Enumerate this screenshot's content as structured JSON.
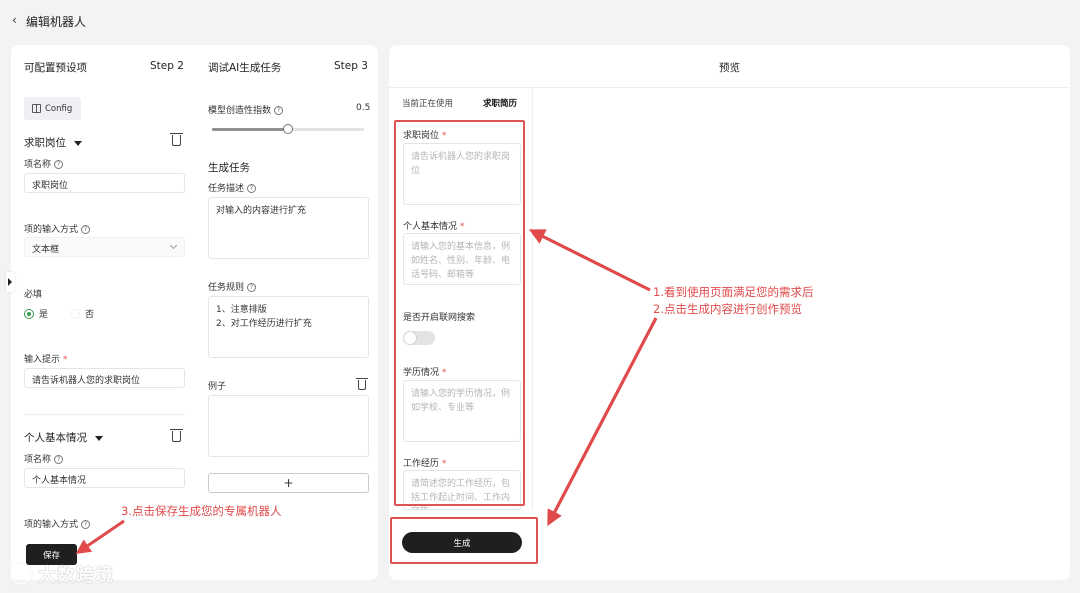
{
  "header": {
    "back_icon": "‹",
    "title": "编辑机器人"
  },
  "config_panel": {
    "title": "可配置预设项",
    "step": "Step 2",
    "config_button": "Config",
    "fields": [
      {
        "group_title": "求职岗位",
        "name_label": "项名称",
        "name_value": "求职岗位",
        "input_type_label": "项的输入方式",
        "input_type_value": "文本框",
        "required_label": "必填",
        "required_yes": "是",
        "required_no": "否",
        "hint_label": "输入提示",
        "hint_value": "请告诉机器人您的求职岗位"
      },
      {
        "group_title": "个人基本情况",
        "name_label": "项名称",
        "name_value": "个人基本情况",
        "input_type_label": "项的输入方式"
      }
    ],
    "save_button": "保存"
  },
  "ai_panel": {
    "title": "调试AI生成任务",
    "step": "Step 3",
    "creativity_label": "模型创造性指数",
    "creativity_value": "0.5",
    "creativity_fraction": 0.5,
    "section_title": "生成任务",
    "task_desc_label": "任务描述",
    "task_desc_value": "对输入的内容进行扩充",
    "task_rules_label": "任务规则",
    "task_rules_lines": [
      "1、注意排版",
      "2、对工作经历进行扩充"
    ],
    "example_label": "例子",
    "add_button": "+"
  },
  "preview_panel": {
    "title": "预览",
    "tab_current": "当前正在使用",
    "tab_active": "求职简历",
    "fields": [
      {
        "label": "求职岗位",
        "placeholder": "请告诉机器人您的求职岗位"
      },
      {
        "label": "个人基本情况",
        "placeholder": "请输入您的基本信息，例如姓名、性别、年龄、电话号码、邮箱等"
      },
      {
        "label": "是否开启联网搜索"
      },
      {
        "label": "学历情况",
        "placeholder": "请输入您的学历情况，例如学校、专业等"
      },
      {
        "label": "工作经历",
        "placeholder": "请简述您的工作经历，包括工作起止时间、工作内容等"
      }
    ],
    "generate_button": "生成"
  },
  "annotations": {
    "note1_line1": "1.看到使用页面满足您的需求后",
    "note1_line2": "2.点击生成内容进行创作预览",
    "note2": "3.点击保存生成您的专属机器人",
    "accent_color": "#e04a4a"
  },
  "watermark": "大数跨境"
}
